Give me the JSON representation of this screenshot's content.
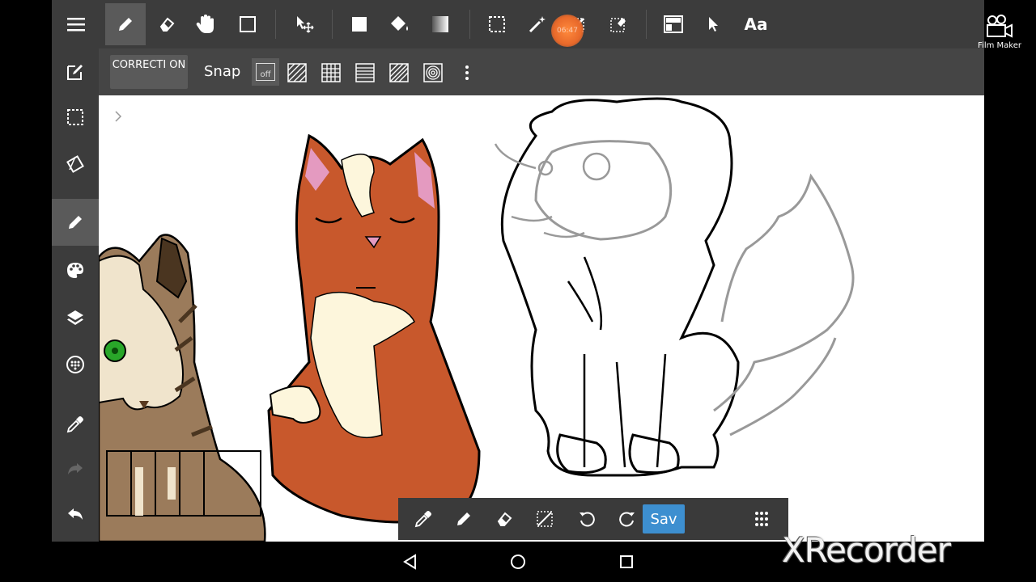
{
  "toolbar": {
    "tools": [
      "menu-icon",
      "pen-icon",
      "eraser-icon",
      "hand-icon",
      "rectangle-icon",
      "move-icon",
      "fill-rect-icon",
      "bucket-icon",
      "gradient-icon",
      "selection-icon",
      "magic-wand-icon",
      "select-pen-icon",
      "select-eraser-icon",
      "panel-icon",
      "operation-icon"
    ],
    "text_tool_label": "Aa",
    "timer_text": "06:47"
  },
  "subtoolbar": {
    "correction_label": "CORRECTI ON",
    "snap_label": "Snap",
    "snap_off_label": "off"
  },
  "bottom_bar": {
    "save_label": "Sav"
  },
  "overlay": {
    "film_maker_label": "Film Maker",
    "recorder_watermark": "XRecorder"
  },
  "colors": {
    "accent": "#3d8fd0",
    "toolbar_bg": "#3c3c3c",
    "timer": "#e8692a"
  }
}
